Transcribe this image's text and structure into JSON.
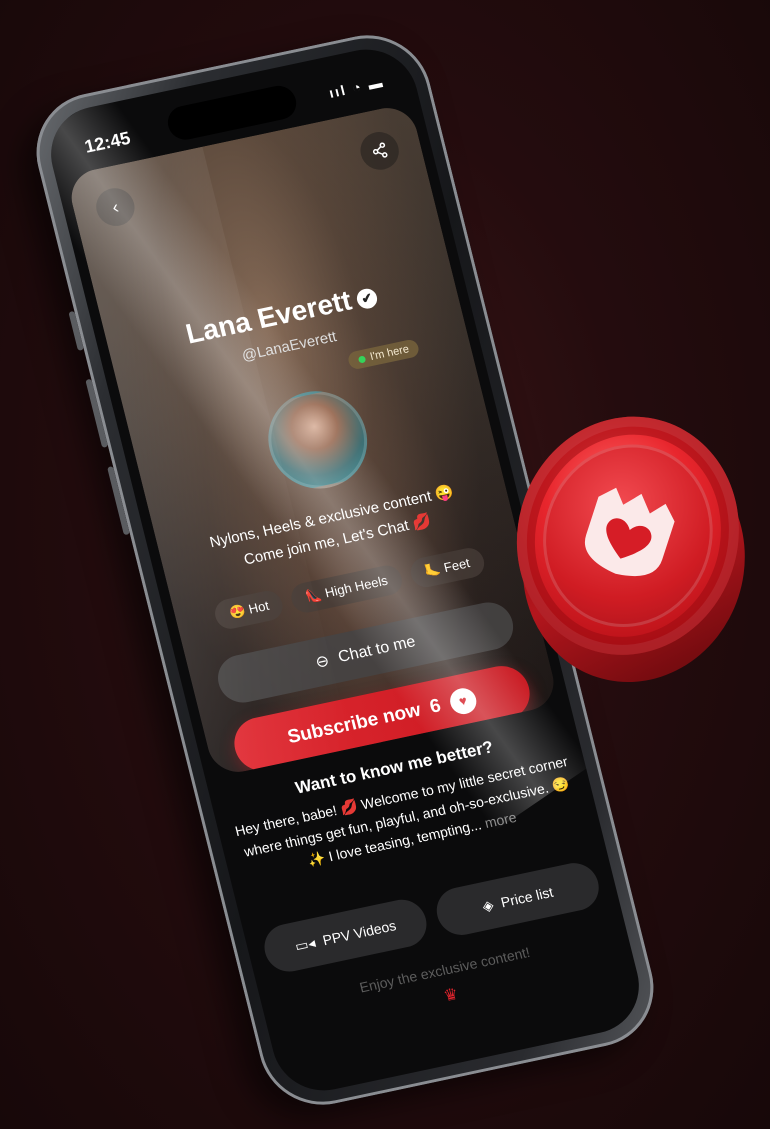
{
  "status": {
    "time": "12:45",
    "icons": "ııl ◔ ▬"
  },
  "profile": {
    "name": "Lana Everett",
    "handle": "@LanaEverett",
    "online_label": "I'm here",
    "bio_line1": "Nylons, Heels & exclusive content 😜",
    "bio_line2": "Come join me, Let's Chat 💋"
  },
  "tags": [
    "😍 Hot",
    "👠 High Heels",
    "🦶 Feet"
  ],
  "buttons": {
    "chat": "Chat to me",
    "subscribe": "Subscribe now",
    "subscribe_price": "6",
    "ppv": "PPV Videos",
    "price_list": "Price list"
  },
  "about": {
    "title": "Want to know me better?",
    "text": "Hey there, babe! 💋 Welcome to my little secret corner where things get fun, playful, and oh-so-exclusive. 😏✨ I love teasing, tempting...",
    "more": "more"
  },
  "footer": "Enjoy the exclusive content!",
  "colors": {
    "accent": "#e0242d",
    "background": "#240c0e"
  },
  "icons": [
    "back-icon",
    "share-icon",
    "verified-icon",
    "chat-icon",
    "video-icon",
    "price-tag-icon",
    "crown-icon",
    "heart-crown-icon"
  ]
}
